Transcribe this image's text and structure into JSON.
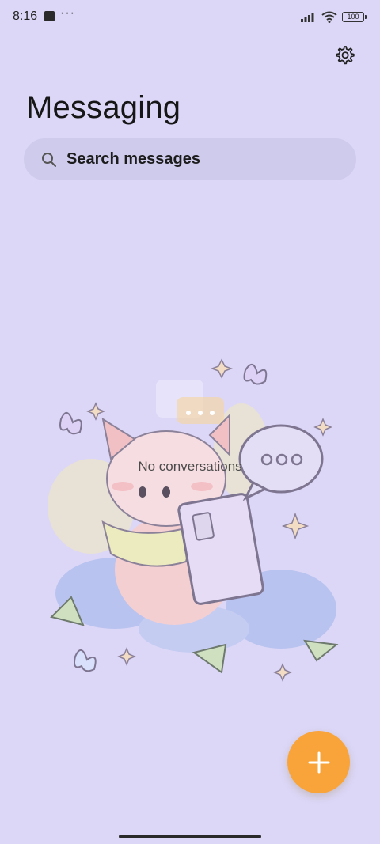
{
  "status_bar": {
    "time": "8:16",
    "dots": "···",
    "battery": "100"
  },
  "header": {
    "title": "Messaging"
  },
  "search": {
    "label": "Search messages"
  },
  "empty_state": {
    "text": "No conversations"
  },
  "icons": {
    "settings": "gear-icon",
    "search": "search-icon",
    "compose": "plus-icon",
    "signal": "signal-icon",
    "wifi": "wifi-icon",
    "battery": "battery-icon"
  },
  "colors": {
    "background": "#dcd7f7",
    "search_bar": "#cfcbec",
    "fab": "#f9a43a"
  }
}
